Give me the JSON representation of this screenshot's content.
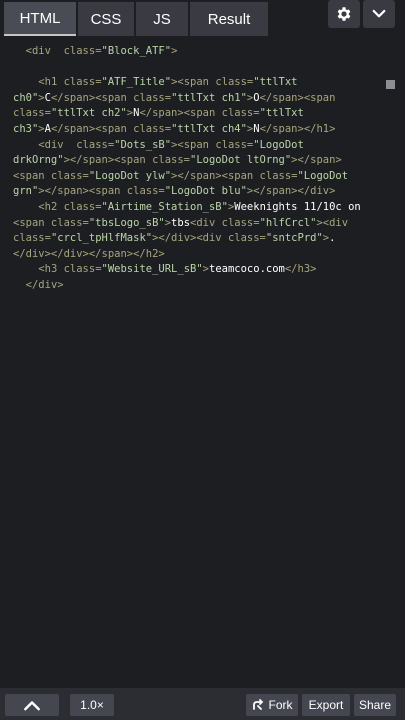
{
  "tabs": [
    {
      "label": "HTML",
      "active": true
    },
    {
      "label": "CSS",
      "active": false
    },
    {
      "label": "JS",
      "active": false
    },
    {
      "label": "Result",
      "active": false
    }
  ],
  "code": {
    "l1": {
      "open": "<div  class=",
      "attr_val": "\"Block_ATF\"",
      "close": ">"
    },
    "l2": {
      "p1": "<h1 class=",
      "v1": "\"ATF_Title\"",
      "p2": "><span class=",
      "v2": "\"ttlTxt",
      "p3_text": "ch0\"",
      "p3": ">",
      "c1": "C",
      "p4": "</span><span class=",
      "v3": "\"ttlTxt ch1\"",
      "p5": ">",
      "c2": "O",
      "p6": "</span><span",
      "p7": "class=",
      "v4": "\"ttlTxt ch2\"",
      "p8": ">",
      "c3": "N",
      "p9": "</span><span class=",
      "v5": "\"ttlTxt",
      "v5b": "ch3\"",
      "p10": ">",
      "c4": "A",
      "p11": "</span><span class=",
      "v6": "\"ttlTxt ch4\"",
      "p12": ">",
      "c5": "N",
      "p13": "</span></h1>"
    },
    "l3": {
      "p1": "<div  class=",
      "v1": "\"Dots_sB\"",
      "p2": "><span class=",
      "v2": "\"LogoDot",
      "v2b": "drkOrng\"",
      "p3": "></span><span class=",
      "v3": "\"LogoDot ltOrng\"",
      "p4": "></span>",
      "p5": "<span class=",
      "v4": "\"LogoDot ylw\"",
      "p6": "></span><span class=",
      "v5": "\"LogoDot",
      "v5b": "grn\"",
      "p7": "></span><span class=",
      "v6": "\"LogoDot blu\"",
      "p8": "></span></div>"
    },
    "l4": {
      "p1": "<h2 class=",
      "v1": "\"Airtime_Station_sB\"",
      "p2": ">",
      "t1": "Weeknights 11/10c on",
      "p3": "<span class=",
      "v2": "\"tbsLogo_sB\"",
      "p4": ">",
      "t2": "tbs",
      "p5": "<div class=",
      "v3": "\"hlfCrcl\"",
      "p6": "><div",
      "p7": "class=",
      "v4": "\"crcl_tpHlfMask\"",
      "p8": "></div><div class=",
      "v5": "\"sntcPrd\"",
      "p9": ">",
      "t3": ".",
      "p10": "</div></div></span></h2>"
    },
    "l5": {
      "p1": "<h3 class=",
      "v1": "\"Website_URL_sB\"",
      "p2": ">",
      "t1": "teamcoco.com",
      "p3": "</h3>"
    },
    "l6": {
      "p1": "</div>"
    }
  },
  "bottom": {
    "zoom": "1.0×",
    "fork": "Fork",
    "export": "Export",
    "share": "Share"
  },
  "icons": {
    "settings": "gear-icon",
    "collapse": "chevron-down-icon",
    "up": "chevron-up-icon",
    "fork": "fork-icon"
  }
}
